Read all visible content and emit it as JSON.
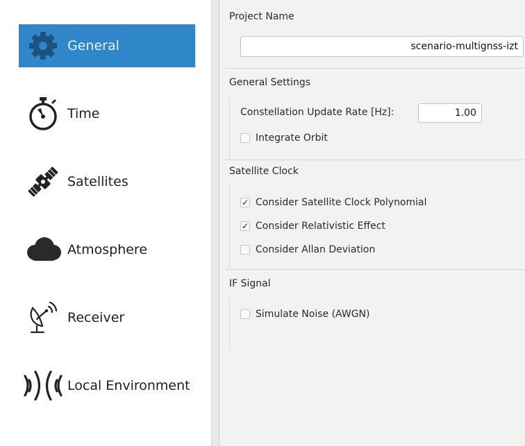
{
  "sidebar": {
    "items": [
      {
        "label": "General",
        "icon": "gear-icon",
        "selected": true
      },
      {
        "label": "Time",
        "icon": "stopwatch-icon",
        "selected": false
      },
      {
        "label": "Satellites",
        "icon": "satellite-icon",
        "selected": false
      },
      {
        "label": "Atmosphere",
        "icon": "cloud-icon",
        "selected": false
      },
      {
        "label": "Receiver",
        "icon": "satellite-dish-icon",
        "selected": false
      },
      {
        "label": "Local Environment",
        "icon": "signal-waves-icon",
        "selected": false
      }
    ]
  },
  "main": {
    "project": {
      "title": "Project Name",
      "value": "scenario-multignss-izt"
    },
    "general_settings": {
      "title": "General Settings",
      "update_rate_label": "Constellation Update Rate [Hz]:",
      "update_rate_value": "1.00",
      "integrate_orbit": {
        "label": "Integrate Orbit",
        "checked": false
      }
    },
    "satellite_clock": {
      "title": "Satellite Clock",
      "options": [
        {
          "label": "Consider Satellite Clock Polynomial",
          "checked": true
        },
        {
          "label": "Consider Relativistic Effect",
          "checked": true
        },
        {
          "label": "Consider Allan Deviation",
          "checked": false
        }
      ]
    },
    "if_signal": {
      "title": "IF Signal",
      "simulate_noise": {
        "label": "Simulate Noise (AWGN)",
        "checked": false
      }
    }
  },
  "colors": {
    "selection": "#2f86c8",
    "sidebar_bg": "#ffffff",
    "panel_bg": "#f2f2f2"
  },
  "check_mark": "✓"
}
